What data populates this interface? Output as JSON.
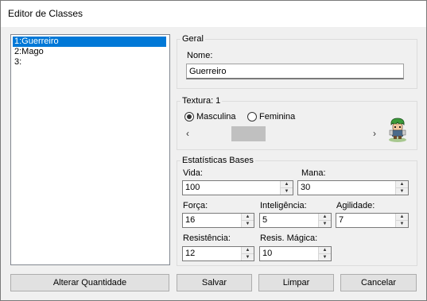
{
  "window": {
    "title": "Editor de Classes"
  },
  "class_list": {
    "items": [
      {
        "label": "1:Guerreiro",
        "selected": true
      },
      {
        "label": "2:Mago",
        "selected": false
      },
      {
        "label": "3:",
        "selected": false
      }
    ]
  },
  "geral": {
    "group_title": "Geral",
    "name_label": "Nome:",
    "name_value": "Guerreiro"
  },
  "textura": {
    "group_title": "Textura: 1",
    "radio_masculina": "Masculina",
    "radio_feminina": "Feminina",
    "selected": "Masculina",
    "scroll_left": "‹",
    "scroll_right": "›"
  },
  "stats": {
    "group_title": "Estatísticas Bases",
    "vida_label": "Vida:",
    "vida_value": "100",
    "mana_label": "Mana:",
    "mana_value": "30",
    "forca_label": "Força:",
    "forca_value": "16",
    "inteligencia_label": "Inteligência:",
    "inteligencia_value": "5",
    "agilidade_label": "Agilidade:",
    "agilidade_value": "7",
    "resistencia_label": "Resistência:",
    "resistencia_value": "12",
    "resis_magica_label": "Resis. Mágica:",
    "resis_magica_value": "10"
  },
  "buttons": {
    "alterar_quantidade": "Alterar Quantidade",
    "salvar": "Salvar",
    "limpar": "Limpar",
    "cancelar": "Cancelar"
  },
  "colors": {
    "selection": "#0078d7",
    "window_bg": "#f0f0f0",
    "button_bg": "#e1e1e1"
  }
}
